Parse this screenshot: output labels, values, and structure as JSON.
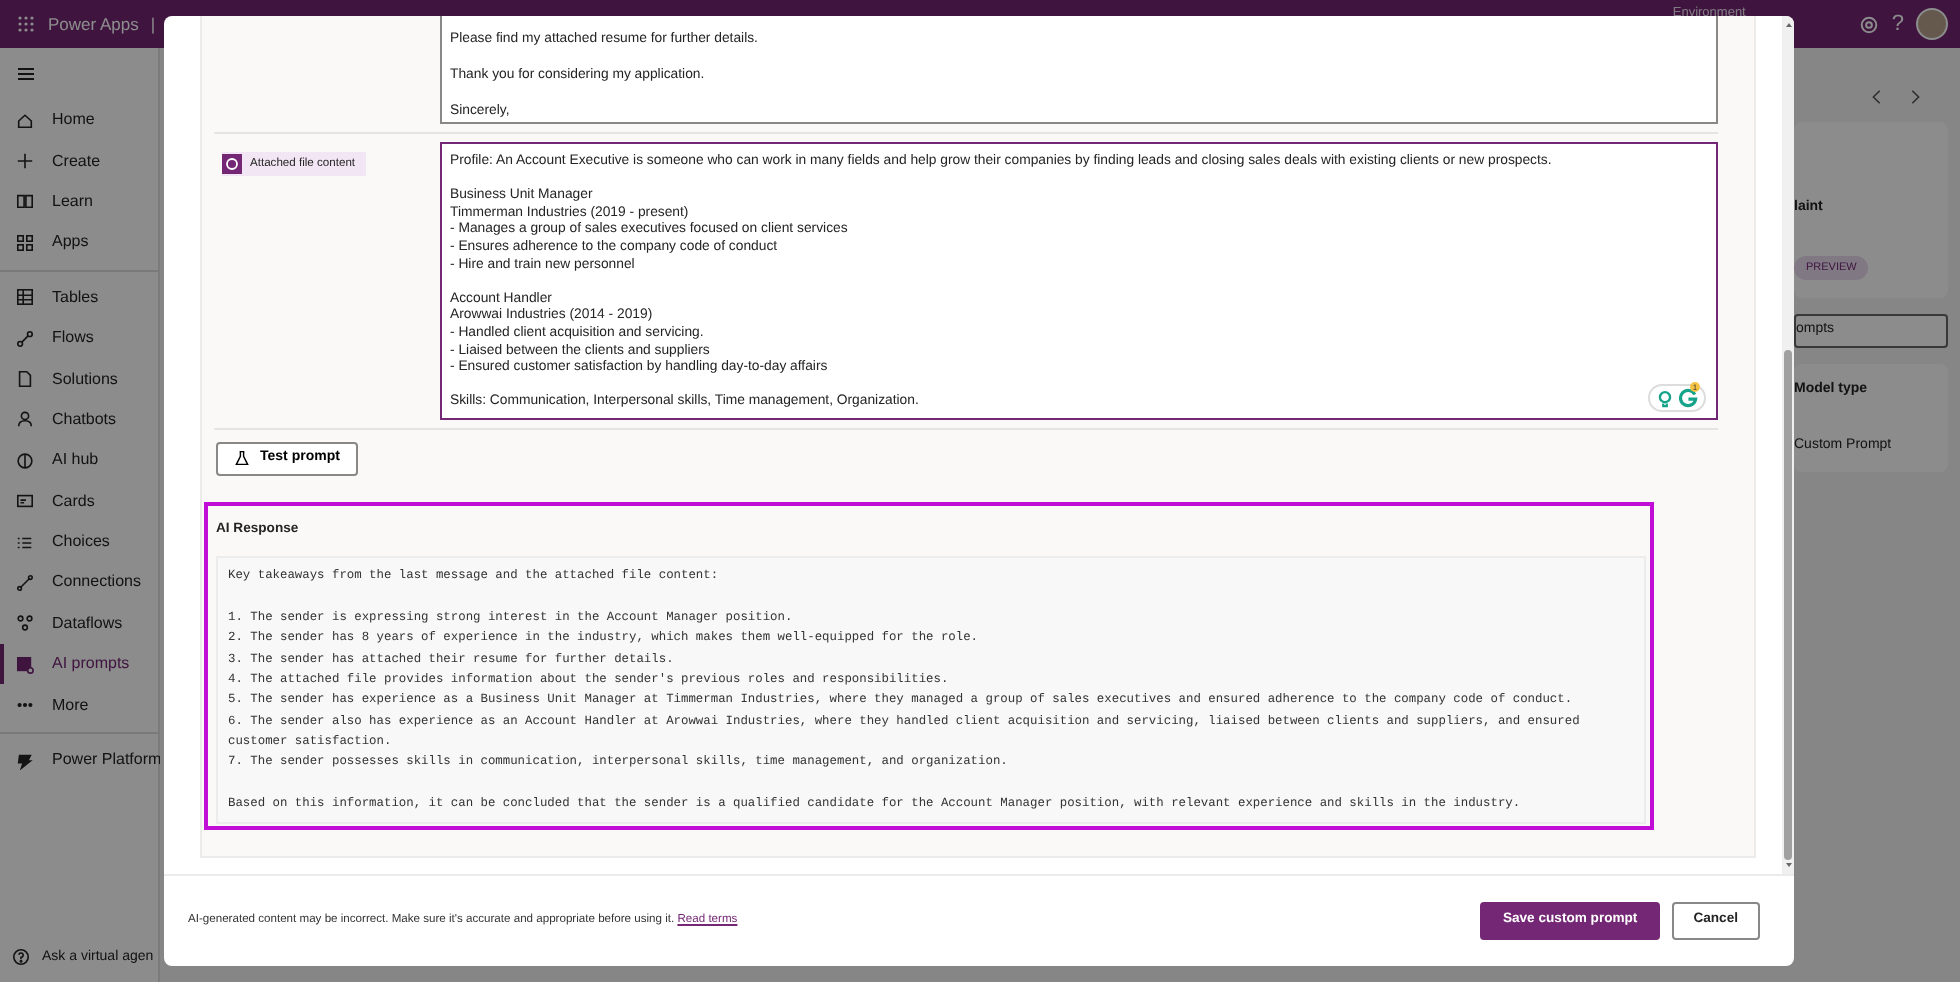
{
  "app": {
    "title": "Power Apps",
    "separator": "|",
    "environment_label": "Environment",
    "help": "?"
  },
  "nav": {
    "groups": [
      [
        {
          "label": "Home",
          "selected": false
        },
        {
          "label": "Create",
          "selected": false
        },
        {
          "label": "Learn",
          "selected": false
        },
        {
          "label": "Apps",
          "selected": false
        }
      ],
      [
        {
          "label": "Tables",
          "selected": false
        },
        {
          "label": "Flows",
          "selected": false
        },
        {
          "label": "Solutions",
          "selected": false
        },
        {
          "label": "Chatbots",
          "selected": false
        },
        {
          "label": "AI hub",
          "selected": false
        },
        {
          "label": "Cards",
          "selected": false
        },
        {
          "label": "Choices",
          "selected": false
        },
        {
          "label": "Connections",
          "selected": false
        },
        {
          "label": "Dataflows",
          "selected": false
        },
        {
          "label": "AI prompts",
          "selected": true
        },
        {
          "label": "More",
          "selected": false
        }
      ],
      [
        {
          "label": "Power Platform",
          "selected": false
        }
      ]
    ],
    "footer": "Ask a virtual agen"
  },
  "background": {
    "card_title": "laint",
    "card_badge": "PREVIEW",
    "search_text": "ompts",
    "column_header": "Model type",
    "cell": "Custom Prompt"
  },
  "dialog": {
    "message_field": "Please find my attached resume for further details.\n\nThank you for considering my application.\n\nSincerely,",
    "attachment_label": "Attached file content",
    "attachment_field": "Profile: An Account Executive is someone who can work in many fields and help grow their companies by finding leads and closing sales deals with existing clients or new prospects.\n\nBusiness Unit Manager\nTimmerman Industries (2019 - present)\n- Manages a group of sales executives focused on client services\n- Ensures adherence to the company code of conduct\n- Hire and train new personnel\n\nAccount Handler\nArowwai Industries (2014 - 2019)\n- Handled client acquisition and servicing.\n- Liaised between the clients and suppliers\n- Ensured customer satisfaction by handling day-to-day affairs\n\nSkills: Communication, Interpersonal skills, Time management, Organization.",
    "grammar_badge": "1",
    "test_button": "Test prompt",
    "response": {
      "title": "AI Response",
      "text": "Key takeaways from the last message and the attached file content:\n\n1. The sender is expressing strong interest in the Account Manager position.\n2. The sender has 8 years of experience in the industry, which makes them well-equipped for the role.\n3. The sender has attached their resume for further details.\n4. The attached file provides information about the sender's previous roles and responsibilities.\n5. The sender has experience as a Business Unit Manager at Timmerman Industries, where they managed a group of sales executives and ensured adherence to the company code of conduct.\n6. The sender also has experience as an Account Handler at Arowwai Industries, where they handled client acquisition and servicing, liaised between clients and suppliers, and ensured customer satisfaction.\n7. The sender possesses skills in communication, interpersonal skills, time management, and organization.\n\nBased on this information, it can be concluded that the sender is a qualified candidate for the Account Manager position, with relevant experience and skills in the industry."
    },
    "disclaimer": "AI-generated content may be incorrect. Make sure it's accurate and appropriate before using it.",
    "terms_link": "Read terms",
    "buttons": [
      {
        "label": "Save custom prompt",
        "kind": "primary"
      },
      {
        "label": "Cancel",
        "kind": "secondary"
      }
    ]
  }
}
